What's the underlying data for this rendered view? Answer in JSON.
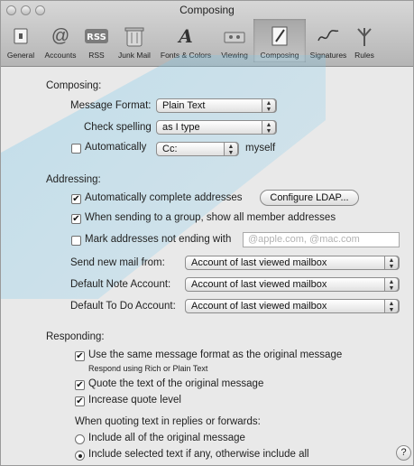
{
  "window": {
    "title": "Composing"
  },
  "toolbar": {
    "items": [
      {
        "label": "General",
        "icon": "general-icon"
      },
      {
        "label": "Accounts",
        "icon": "at-icon"
      },
      {
        "label": "RSS",
        "icon": "rss-icon"
      },
      {
        "label": "Junk Mail",
        "icon": "trash-icon"
      },
      {
        "label": "Fonts & Colors",
        "icon": "font-icon"
      },
      {
        "label": "Viewing",
        "icon": "viewing-icon"
      },
      {
        "label": "Composing",
        "icon": "compose-icon",
        "selected": true
      },
      {
        "label": "Signatures",
        "icon": "signature-icon"
      },
      {
        "label": "Rules",
        "icon": "rules-icon"
      }
    ]
  },
  "composing": {
    "heading": "Composing:",
    "message_format_label": "Message Format:",
    "message_format_value": "Plain Text",
    "check_spelling_label": "Check spelling",
    "check_spelling_value": "as I type",
    "automatically_label": "Automatically",
    "automatically_checked": false,
    "cc_value": "Cc:",
    "myself_label": "myself"
  },
  "addressing": {
    "heading": "Addressing:",
    "auto_complete_label": "Automatically complete addresses",
    "auto_complete_checked": true,
    "configure_ldap_label": "Configure LDAP...",
    "group_label": "When sending to a group, show all member addresses",
    "group_checked": true,
    "mark_label": "Mark addresses not ending with",
    "mark_checked": false,
    "mark_placeholder": "@apple.com, @mac.com",
    "send_new_mail_label": "Send new mail from:",
    "send_new_mail_value": "Account of last viewed mailbox",
    "default_note_label": "Default Note Account:",
    "default_note_value": "Account of last viewed mailbox",
    "default_todo_label": "Default To Do Account:",
    "default_todo_value": "Account of last viewed mailbox"
  },
  "responding": {
    "heading": "Responding:",
    "same_format_label": "Use the same message format as the original message",
    "same_format_checked": true,
    "same_format_sub": "Respond using Rich or Plain Text",
    "quote_text_label": "Quote the text of the original message",
    "quote_text_checked": true,
    "increase_quote_label": "Increase quote level",
    "increase_quote_checked": true,
    "when_quoting_label": "When quoting text in replies or forwards:",
    "include_all_label": "Include all of the original message",
    "include_selected_label": "Include selected text if any, otherwise include all",
    "selected_option": "include_selected"
  },
  "help_label": "?"
}
